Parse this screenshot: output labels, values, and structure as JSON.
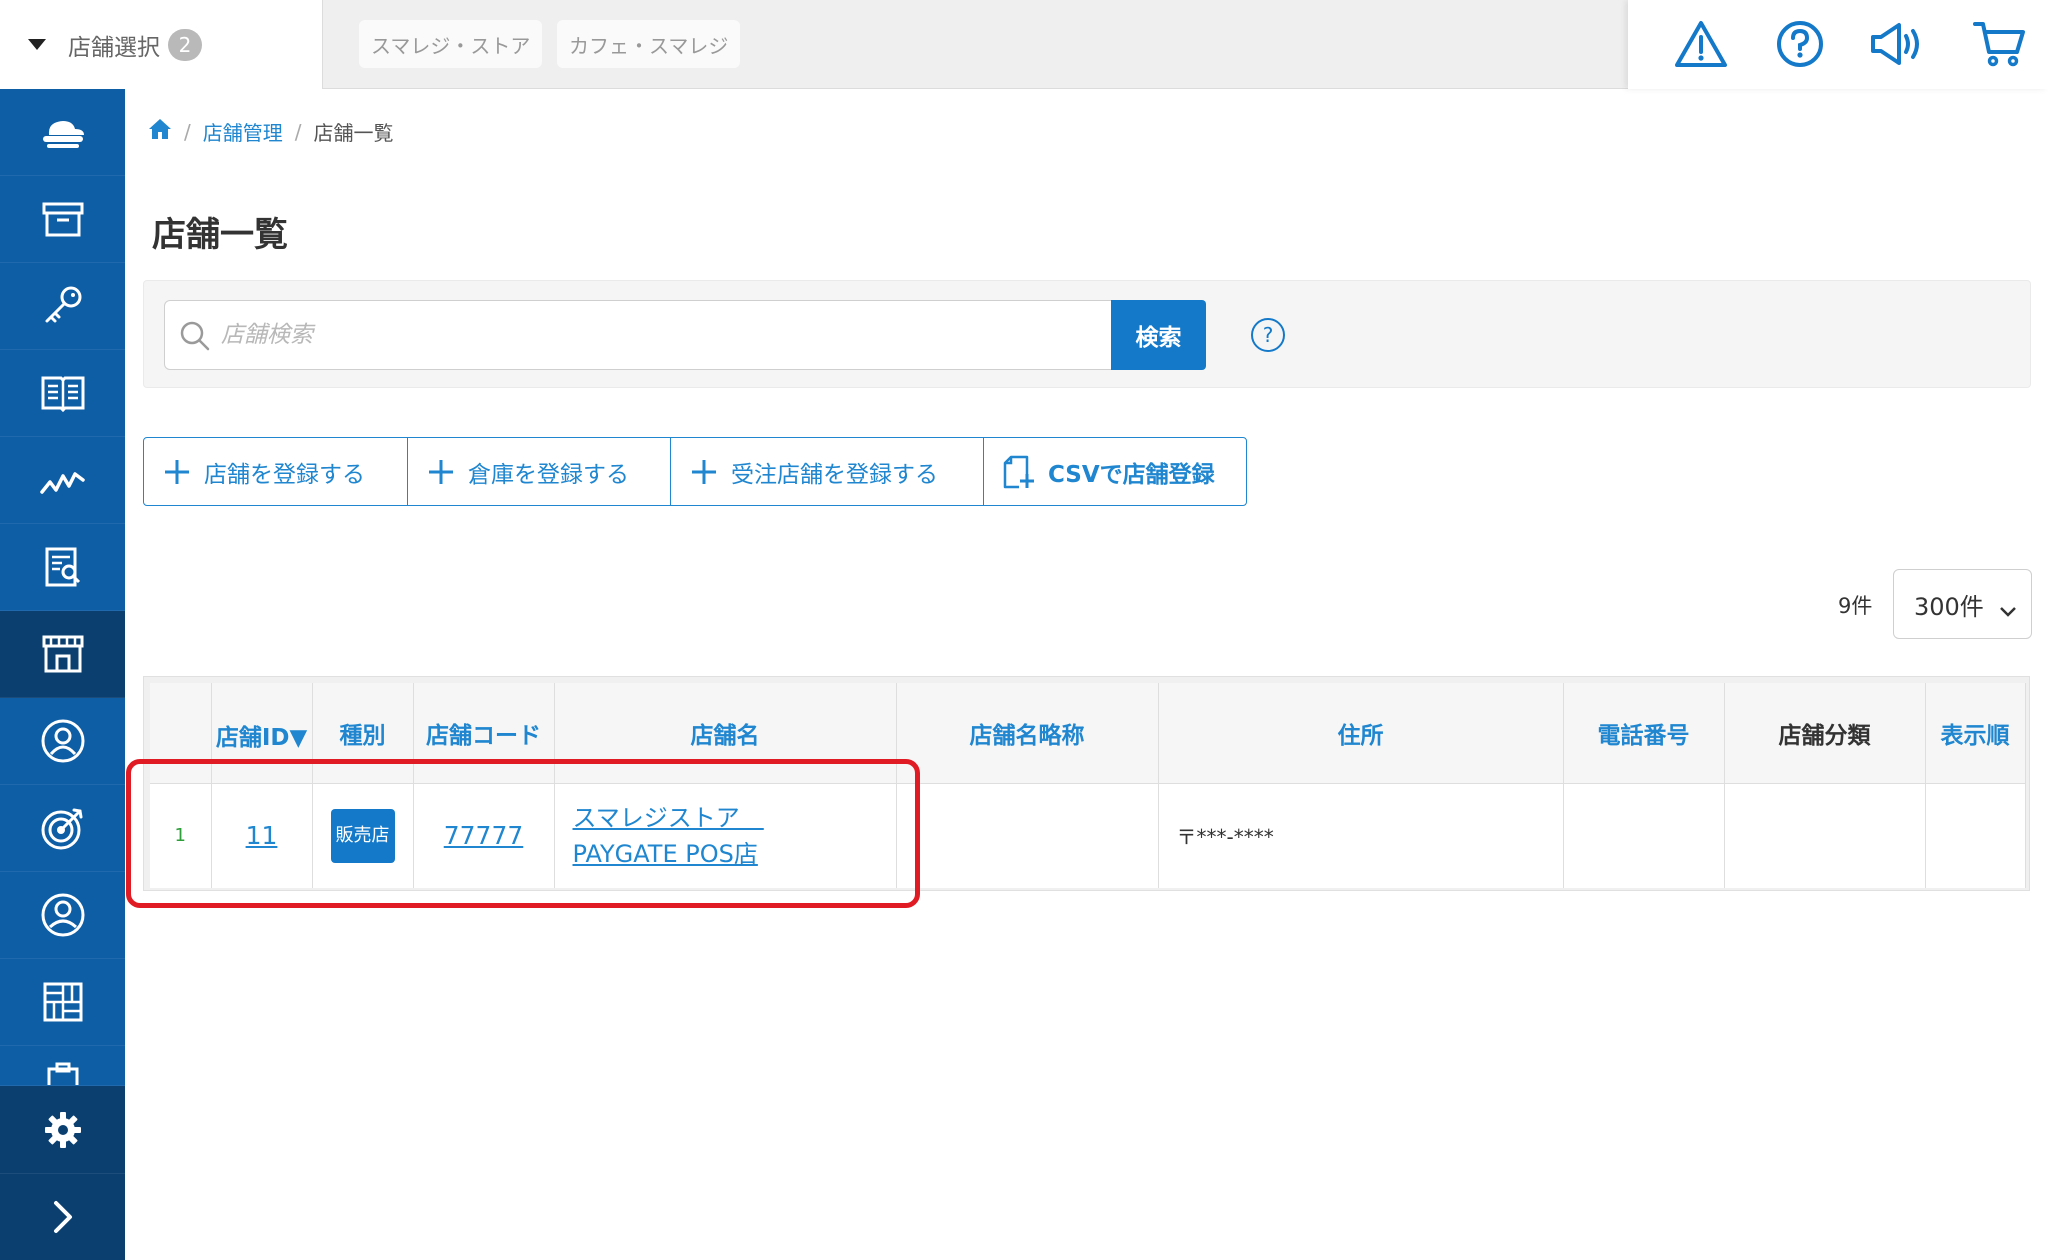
{
  "topbar": {
    "store_select_label": "店舗選択",
    "store_select_count": "2",
    "chips": [
      "スマレジ・ストア",
      "カフェ・スマレジ"
    ],
    "icons": [
      "warning-icon",
      "help-icon",
      "announcement-icon",
      "cart-icon"
    ]
  },
  "sidebar": {
    "items": [
      "cloud-register-icon",
      "product-box-icon",
      "key-icon",
      "ledger-book-icon",
      "sales-chart-icon",
      "report-icon",
      "store-icon",
      "customer-icon",
      "target-icon",
      "user-icon",
      "apps-grid-icon",
      "clipboard-icon"
    ],
    "active_item": "store-icon",
    "bottom": [
      "settings-gear-icon",
      "expand-chevron-icon"
    ]
  },
  "breadcrumb": {
    "home": "home-icon",
    "parent": "店舗管理",
    "current": "店舗一覧"
  },
  "page": {
    "title": "店舗一覧"
  },
  "search": {
    "placeholder": "店舗検索",
    "button": "検索",
    "help": "?"
  },
  "actions": {
    "register_store": "店舗を登録する",
    "register_warehouse": "倉庫を登録する",
    "register_order_store": "受注店舗を登録する",
    "csv_register": "CSVで店舗登録"
  },
  "listing": {
    "count": "9件",
    "per_page": "300件"
  },
  "table": {
    "headers": {
      "store_id": "店舗ID▼",
      "type": "種別",
      "store_code": "店舗コード",
      "store_name": "店舗名",
      "store_abbr": "店舗名略称",
      "address": "住所",
      "phone": "電話番号",
      "category": "店舗分類",
      "display_order": "表示順"
    },
    "rows": [
      {
        "num": "1",
        "store_id": "11",
        "type": "販売店",
        "store_code": "77777",
        "store_name_line1": "スマレジストア　",
        "store_name_line2": "PAYGATE POS店",
        "store_abbr": "",
        "address": "〒***-****",
        "phone": "",
        "category": "",
        "display_order": ""
      }
    ]
  },
  "colors": {
    "sidebar": "#0e5ea6",
    "sidebar_active": "#0a3f70",
    "primary": "#1479c9",
    "link": "#1f86cf",
    "highlight": "#e01b24",
    "row_number": "#2e9e3a"
  }
}
